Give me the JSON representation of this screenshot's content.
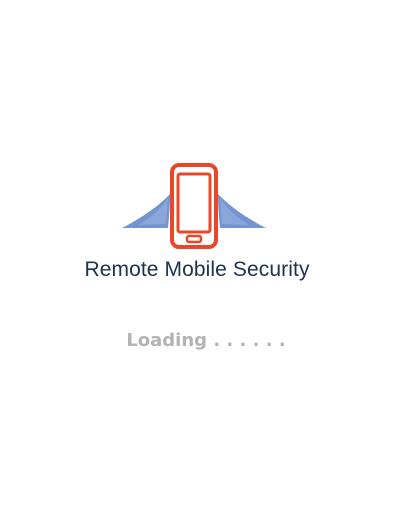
{
  "splash": {
    "app_name": "Remote Mobile Security",
    "loading_text": "Loading . . . . . .",
    "logo_icon": "winged-phone-icon"
  },
  "colors": {
    "background": "#ffffff",
    "app_name": "#1e3250",
    "phone_outline": "#e8472a",
    "wings": "#7494cf",
    "loading_text": "#b3b3b3"
  }
}
